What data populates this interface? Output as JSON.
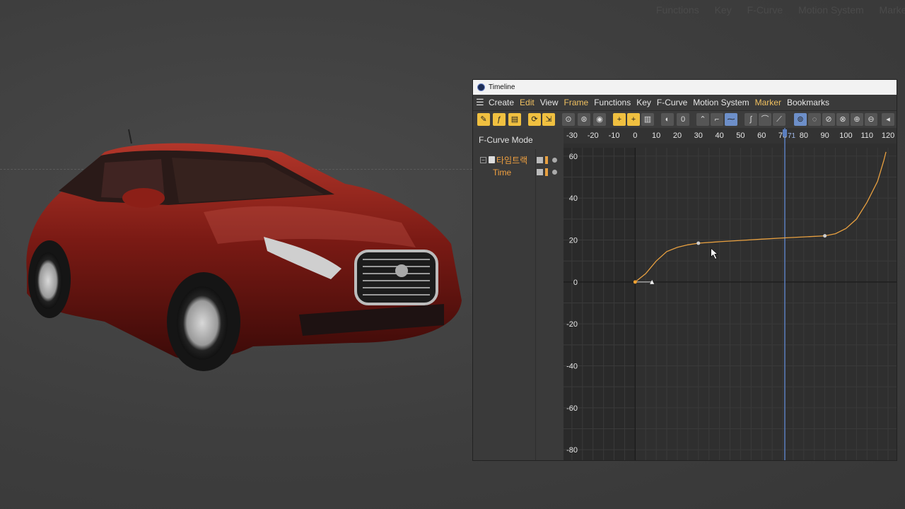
{
  "background_menu": [
    "Functions",
    "Key",
    "F-Curve",
    "Motion System",
    "Marke"
  ],
  "timeline": {
    "title": "Timeline",
    "menu": [
      {
        "label": "Create",
        "highlight": false
      },
      {
        "label": "Edit",
        "highlight": true
      },
      {
        "label": "View",
        "highlight": false
      },
      {
        "label": "Frame",
        "highlight": true
      },
      {
        "label": "Functions",
        "highlight": false
      },
      {
        "label": "Key",
        "highlight": false
      },
      {
        "label": "F-Curve",
        "highlight": false
      },
      {
        "label": "Motion System",
        "highlight": false
      },
      {
        "label": "Marker",
        "highlight": true
      },
      {
        "label": "Bookmarks",
        "highlight": false
      }
    ],
    "mode_label": "F-Curve Mode",
    "tracks": {
      "object": "타임트랙",
      "param": "Time"
    },
    "toolbar_badge": "0"
  },
  "chart_data": {
    "type": "line",
    "x_ticks": [
      -30,
      -20,
      -10,
      0,
      10,
      20,
      30,
      40,
      50,
      60,
      70,
      80,
      90,
      100,
      110,
      120
    ],
    "y_ticks": [
      60,
      40,
      20,
      0,
      -20,
      -40,
      -60,
      -80
    ],
    "xlim": [
      -34,
      124
    ],
    "ylim": [
      -85,
      64
    ],
    "current_frame": 71,
    "keys": [
      {
        "x": 0,
        "y": 0
      },
      {
        "x": 30,
        "y": 18.5
      },
      {
        "x": 90,
        "y": 22
      }
    ],
    "curve": [
      [
        0,
        0
      ],
      [
        5,
        4
      ],
      [
        10,
        10
      ],
      [
        15,
        14.5
      ],
      [
        20,
        16.5
      ],
      [
        25,
        17.7
      ],
      [
        30,
        18.5
      ],
      [
        40,
        19.2
      ],
      [
        50,
        19.8
      ],
      [
        60,
        20.4
      ],
      [
        70,
        21
      ],
      [
        80,
        21.5
      ],
      [
        90,
        22
      ],
      [
        95,
        23
      ],
      [
        100,
        25.5
      ],
      [
        105,
        30
      ],
      [
        110,
        38
      ],
      [
        115,
        48
      ],
      [
        118,
        58
      ],
      [
        119,
        62
      ]
    ],
    "grid": true,
    "colors": {
      "curve": "#e8a040",
      "playhead": "#5b7fbf",
      "grid": "#3a3a3a",
      "axis": "#1a1a1a"
    }
  }
}
